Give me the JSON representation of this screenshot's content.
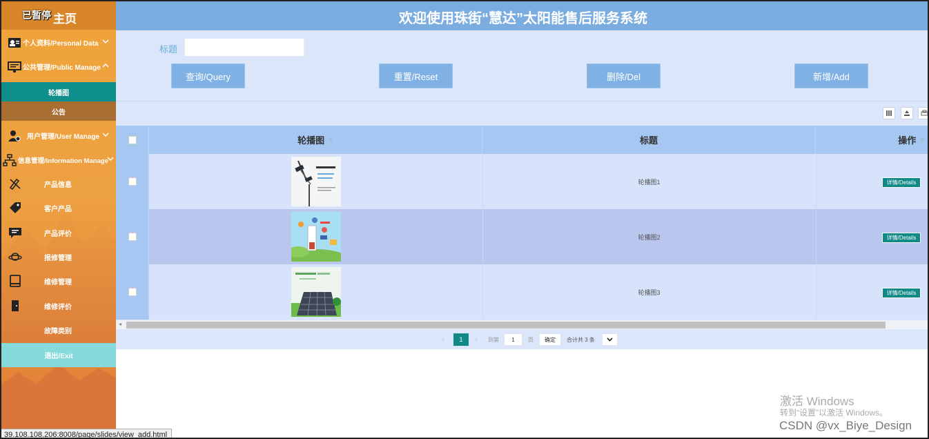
{
  "colors": {
    "sidebar_accent": "#0f8f8c",
    "topbar": "#7aace0",
    "button": "#7fb1e4",
    "detail_button": "#0f8a87",
    "exit": "#86dadb"
  },
  "sidebar": {
    "paused_label": "已暂停",
    "home": "主页",
    "groups": [
      {
        "label": "个人资料/Personal Data",
        "icon": "id-card-icon"
      },
      {
        "label": "公共管理/Public Manage",
        "icon": "monitor-icon"
      }
    ],
    "public_sub": [
      {
        "label": "轮播图"
      },
      {
        "label": "公告"
      }
    ],
    "groups2": [
      {
        "label": "用户管理/User Manage",
        "icon": "user-gear-icon"
      },
      {
        "label": "信息管理/Information Manage",
        "icon": "sitemap-icon"
      }
    ],
    "info_items": [
      {
        "label": "产品信息",
        "icon": "pencil-ruler-icon"
      },
      {
        "label": "客户产品",
        "icon": "tag-icon"
      },
      {
        "label": "产品评价",
        "icon": "comment-icon"
      },
      {
        "label": "报修管理",
        "icon": "planet-icon"
      },
      {
        "label": "维修管理",
        "icon": "book-icon"
      },
      {
        "label": "维修评价",
        "icon": "door-icon"
      },
      {
        "label": "故障类别",
        "icon": ""
      }
    ],
    "exit": "退出/Exit"
  },
  "header": {
    "title": "欢迎使用珠街“慧达”太阳能售后服务系统"
  },
  "search": {
    "label": "标题",
    "value": ""
  },
  "buttons": {
    "query": "查询/Query",
    "reset": "重置/Reset",
    "delete": "删除/Del",
    "add": "新增/Add"
  },
  "table": {
    "columns": {
      "image": "轮播图",
      "title": "标题",
      "action": "操作"
    },
    "rows": [
      {
        "title": "轮播图1",
        "action": "详情/Details"
      },
      {
        "title": "轮播图2",
        "action": "详情/Details"
      },
      {
        "title": "轮播图3",
        "action": "详情/Details"
      }
    ]
  },
  "pager": {
    "current": "1",
    "goto_label": "到第",
    "page_input": "1",
    "page_unit": "页",
    "confirm": "确定",
    "total": "合计共 3 条"
  },
  "status_url": "39.108.108.206:8008/page/slides/view_add.html",
  "watermark": {
    "line1": "激活 Windows",
    "line2": "转到“设置”以激活 Windows。",
    "line3": "CSDN @vx_Biye_Design"
  }
}
